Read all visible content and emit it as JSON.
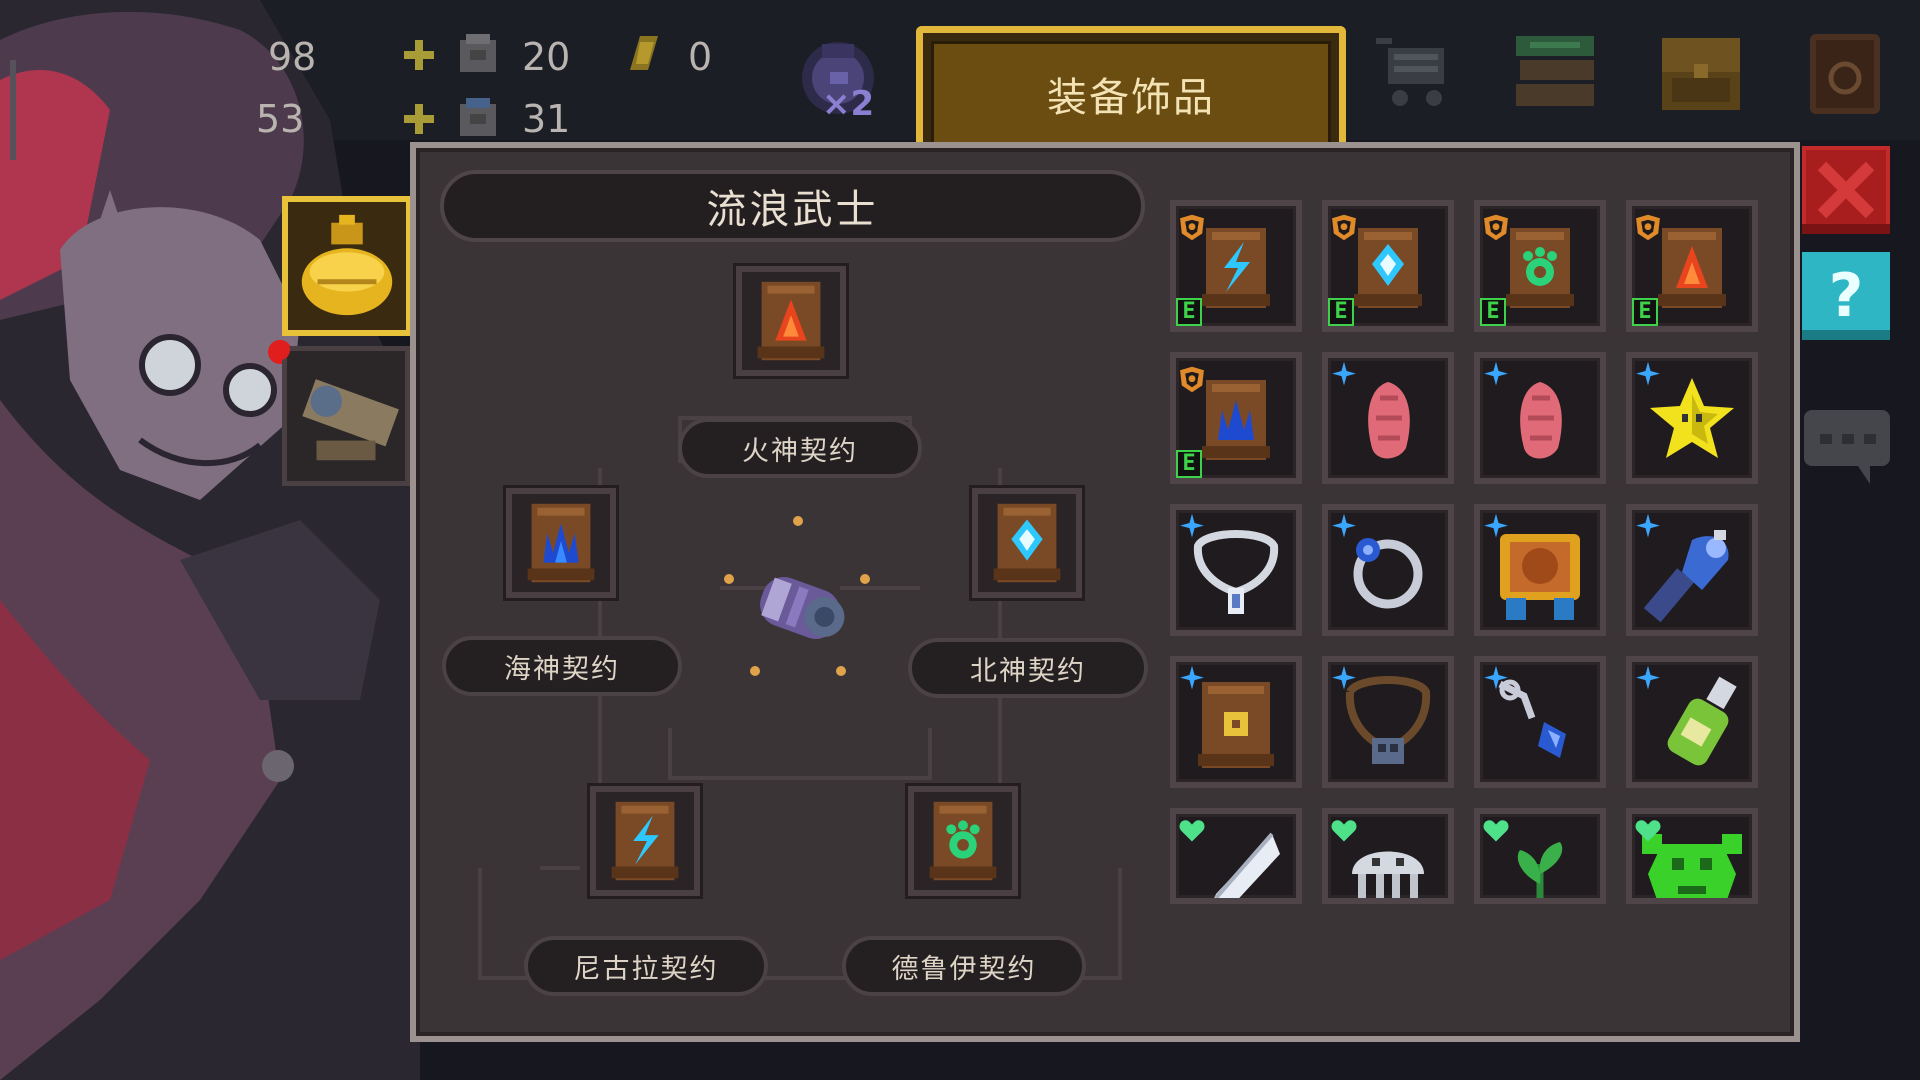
{
  "hud": {
    "res_top_left": "98",
    "res_bottom_left": "53",
    "res_a_value": "20",
    "res_b_value": "0",
    "res_c_value": "31",
    "potion_multiplier": "×2"
  },
  "window": {
    "tab_title": "装备饰品",
    "character_name": "流浪武士"
  },
  "contracts": [
    {
      "id": "fire",
      "label": "火神契约"
    },
    {
      "id": "sea",
      "label": "海神契约"
    },
    {
      "id": "north",
      "label": "北神契约"
    },
    {
      "id": "nikola",
      "label": "尼古拉契约"
    },
    {
      "id": "druid",
      "label": "德鲁伊契约"
    }
  ],
  "grid": {
    "rows": [
      [
        {
          "item": "lightning-scroll",
          "badge": "shield",
          "equipped": "E"
        },
        {
          "item": "frost-scroll",
          "badge": "shield",
          "equipped": "E"
        },
        {
          "item": "druid-scroll",
          "badge": "shield",
          "equipped": "E"
        },
        {
          "item": "fire-scroll",
          "badge": "shield",
          "equipped": "E"
        }
      ],
      [
        {
          "item": "sea-scroll",
          "badge": "shield",
          "equipped": "E"
        },
        {
          "item": "pink-crystal",
          "badge": "star",
          "equipped": ""
        },
        {
          "item": "pink-crystal",
          "badge": "star",
          "equipped": ""
        },
        {
          "item": "yellow-star",
          "badge": "star",
          "equipped": ""
        }
      ],
      [
        {
          "item": "silver-necklace",
          "badge": "star",
          "equipped": ""
        },
        {
          "item": "blue-ring",
          "badge": "star",
          "equipped": ""
        },
        {
          "item": "orange-amulet",
          "badge": "star",
          "equipped": ""
        },
        {
          "item": "blue-torch",
          "badge": "star",
          "equipped": ""
        }
      ],
      [
        {
          "item": "plain-scroll",
          "badge": "star",
          "equipped": ""
        },
        {
          "item": "bead-necklace",
          "badge": "star",
          "equipped": ""
        },
        {
          "item": "blue-pendant",
          "badge": "star",
          "equipped": ""
        },
        {
          "item": "green-bottle",
          "badge": "star",
          "equipped": ""
        }
      ],
      [
        {
          "item": "white-feather",
          "badge": "heart",
          "equipped": ""
        },
        {
          "item": "white-jellyfish",
          "badge": "heart",
          "equipped": ""
        },
        {
          "item": "green-sprout",
          "badge": "heart",
          "equipped": ""
        },
        {
          "item": "green-frog",
          "badge": "heart",
          "equipped": ""
        }
      ]
    ]
  },
  "colors": {
    "accent_gold": "#e2b83a",
    "close_red": "#c42a2a",
    "help_teal": "#2fb6c4",
    "equip_green": "#3dd24a",
    "badge_orange": "#e08a2a",
    "badge_blue": "#3aa6ff",
    "badge_green": "#4fe08a"
  },
  "side_buttons": {
    "help_label": "?"
  }
}
